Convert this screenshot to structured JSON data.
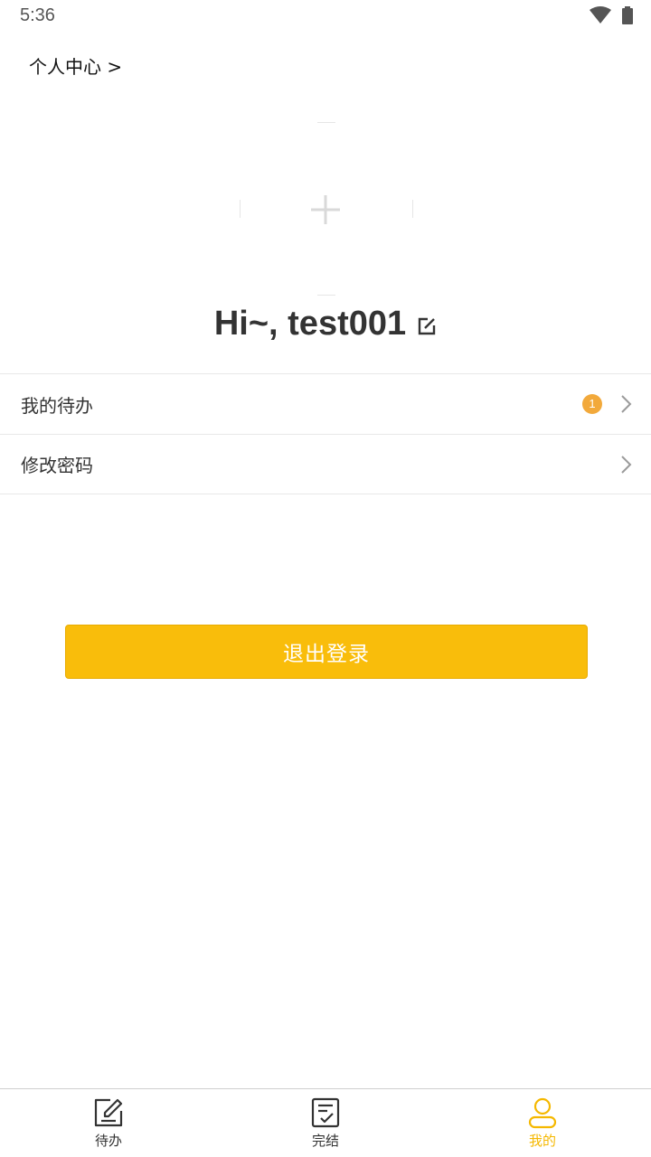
{
  "status_bar": {
    "time": "5:36",
    "icons": [
      "wifi-icon",
      "battery-icon"
    ]
  },
  "header": {
    "breadcrumb": "个人中心 >"
  },
  "profile": {
    "avatar_icon": "plus-icon",
    "greeting": "Hi~, test001",
    "edit_icon": "edit-icon"
  },
  "menu": {
    "items": [
      {
        "label": "我的待办",
        "badge": "1"
      },
      {
        "label": "修改密码"
      }
    ]
  },
  "logout": {
    "label": "退出登录"
  },
  "tab_bar": {
    "tabs": [
      {
        "label": "待办",
        "icon": "edit-note-icon"
      },
      {
        "label": "完结",
        "icon": "checklist-icon"
      },
      {
        "label": "我的",
        "icon": "user-icon",
        "active": true
      }
    ]
  },
  "colors": {
    "accent": "#f9bd0b",
    "badge": "#f2a93b",
    "active_tab": "#f5b800",
    "text": "#333333"
  }
}
